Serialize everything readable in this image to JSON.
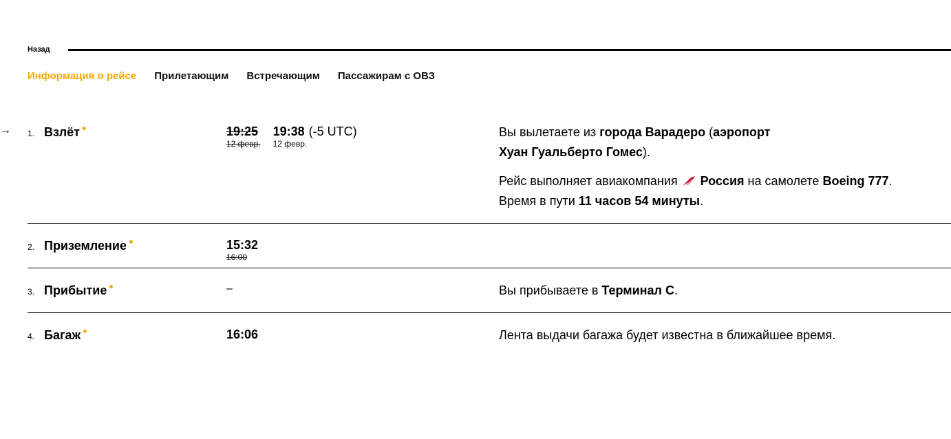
{
  "nav": {
    "back_label": "Назад"
  },
  "tabs": [
    {
      "label": "Информация о рейсе",
      "active": true
    },
    {
      "label": "Прилетающим",
      "active": false
    },
    {
      "label": "Встречающим",
      "active": false
    },
    {
      "label": "Пассажирам с ОВЗ",
      "active": false
    }
  ],
  "side_arrow": "→",
  "steps": [
    {
      "num": "1.",
      "title": "Взлёт",
      "scheduled_time": "19:25",
      "scheduled_date": "12 февр.",
      "actual_time": "19:38",
      "actual_date": "12 февр.",
      "utc": "(-5 UTC)",
      "info": {
        "p1_pre": "Вы вылетаете из ",
        "p1_city": "города Варадеро",
        "p1_mid": " (",
        "p1_airport_word": "аэропорт",
        "p1_airport_name": "Хуан Гуальберто Гомес",
        "p1_post": ").",
        "p2_pre": "Рейс выполняет авиакомпания ",
        "p2_airline": "Россия",
        "p2_mid": " на самолете ",
        "p2_aircraft": "Boeing 777",
        "p2_post": ".",
        "p3_pre": "Время в пути ",
        "p3_duration": "11 часов 54 минуты",
        "p3_post": "."
      }
    },
    {
      "num": "2.",
      "title": "Приземление",
      "actual_time": "15:32",
      "scheduled_time": "16:00"
    },
    {
      "num": "3.",
      "title": "Прибытие",
      "time": "–",
      "info": {
        "pre": "Вы прибываете в ",
        "terminal": "Терминал C",
        "post": "."
      }
    },
    {
      "num": "4.",
      "title": "Багаж",
      "time": "16:06",
      "info": {
        "text": "Лента выдачи багажа будет известна в ближайшее время."
      }
    }
  ],
  "colors": {
    "accent": "#f5a800",
    "text": "#000000",
    "airline_red": "#c8102e"
  },
  "icons": {
    "airline_logo": "airline-logo-icon",
    "status_dot": "status-dot-icon"
  }
}
